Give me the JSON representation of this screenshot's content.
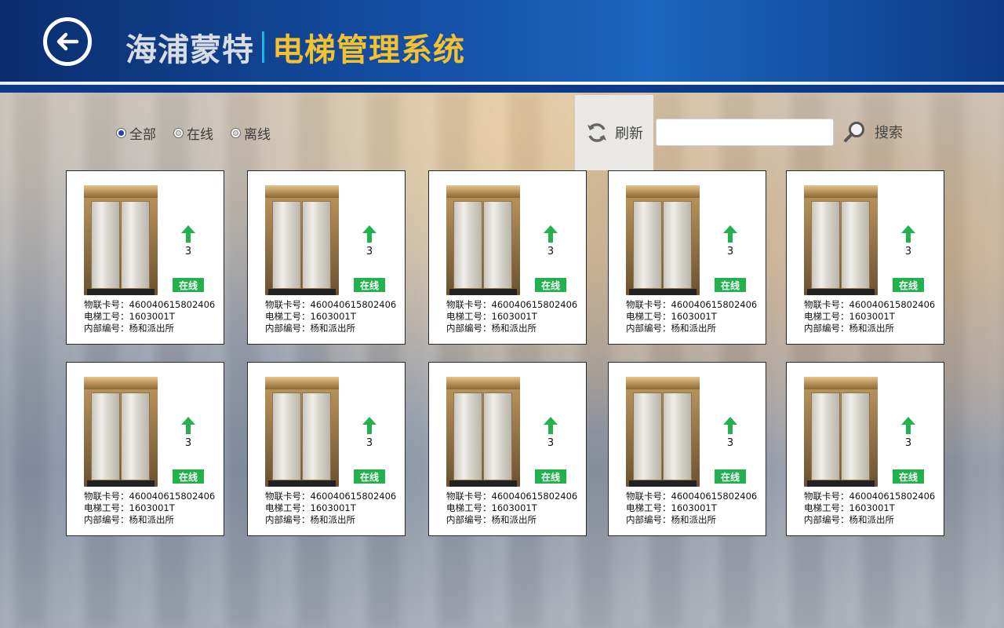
{
  "header": {
    "company": "海浦蒙特",
    "system": "电梯管理系统"
  },
  "filters": [
    {
      "label": "全部",
      "checked": true
    },
    {
      "label": "在线",
      "checked": false
    },
    {
      "label": "离线",
      "checked": false
    }
  ],
  "toolbar": {
    "refresh_label": "刷新",
    "search_value": "",
    "search_label": "搜索"
  },
  "elevators": [
    {
      "floor": "3",
      "direction": "up",
      "status": "在线",
      "iot_label": "物联卡号：",
      "iot_value": "460040615802406",
      "work_label": "电梯工号：",
      "work_value": "1603001T",
      "internal_label": "内部编号：",
      "internal_value": "杨和派出所"
    },
    {
      "floor": "3",
      "direction": "up",
      "status": "在线",
      "iot_label": "物联卡号：",
      "iot_value": "460040615802406",
      "work_label": "电梯工号：",
      "work_value": "1603001T",
      "internal_label": "内部编号：",
      "internal_value": "杨和派出所"
    },
    {
      "floor": "3",
      "direction": "up",
      "status": "在线",
      "iot_label": "物联卡号：",
      "iot_value": "460040615802406",
      "work_label": "电梯工号：",
      "work_value": "1603001T",
      "internal_label": "内部编号：",
      "internal_value": "杨和派出所"
    },
    {
      "floor": "3",
      "direction": "up",
      "status": "在线",
      "iot_label": "物联卡号：",
      "iot_value": "460040615802406",
      "work_label": "电梯工号：",
      "work_value": "1603001T",
      "internal_label": "内部编号：",
      "internal_value": "杨和派出所"
    },
    {
      "floor": "3",
      "direction": "up",
      "status": "在线",
      "iot_label": "物联卡号：",
      "iot_value": "460040615802406",
      "work_label": "电梯工号：",
      "work_value": "1603001T",
      "internal_label": "内部编号：",
      "internal_value": "杨和派出所"
    },
    {
      "floor": "3",
      "direction": "up",
      "status": "在线",
      "iot_label": "物联卡号：",
      "iot_value": "460040615802406",
      "work_label": "电梯工号：",
      "work_value": "1603001T",
      "internal_label": "内部编号：",
      "internal_value": "杨和派出所"
    },
    {
      "floor": "3",
      "direction": "up",
      "status": "在线",
      "iot_label": "物联卡号：",
      "iot_value": "460040615802406",
      "work_label": "电梯工号：",
      "work_value": "1603001T",
      "internal_label": "内部编号：",
      "internal_value": "杨和派出所"
    },
    {
      "floor": "3",
      "direction": "up",
      "status": "在线",
      "iot_label": "物联卡号：",
      "iot_value": "460040615802406",
      "work_label": "电梯工号：",
      "work_value": "1603001T",
      "internal_label": "内部编号：",
      "internal_value": "杨和派出所"
    },
    {
      "floor": "3",
      "direction": "up",
      "status": "在线",
      "iot_label": "物联卡号：",
      "iot_value": "460040615802406",
      "work_label": "电梯工号：",
      "work_value": "1603001T",
      "internal_label": "内部编号：",
      "internal_value": "杨和派出所"
    },
    {
      "floor": "3",
      "direction": "up",
      "status": "在线",
      "iot_label": "物联卡号：",
      "iot_value": "460040615802406",
      "work_label": "电梯工号：",
      "work_value": "1603001T",
      "internal_label": "内部编号：",
      "internal_value": "杨和派出所"
    }
  ],
  "colors": {
    "online": "#22b14c",
    "brand_accent": "#f4c230",
    "header_blue": "#1552a8"
  }
}
